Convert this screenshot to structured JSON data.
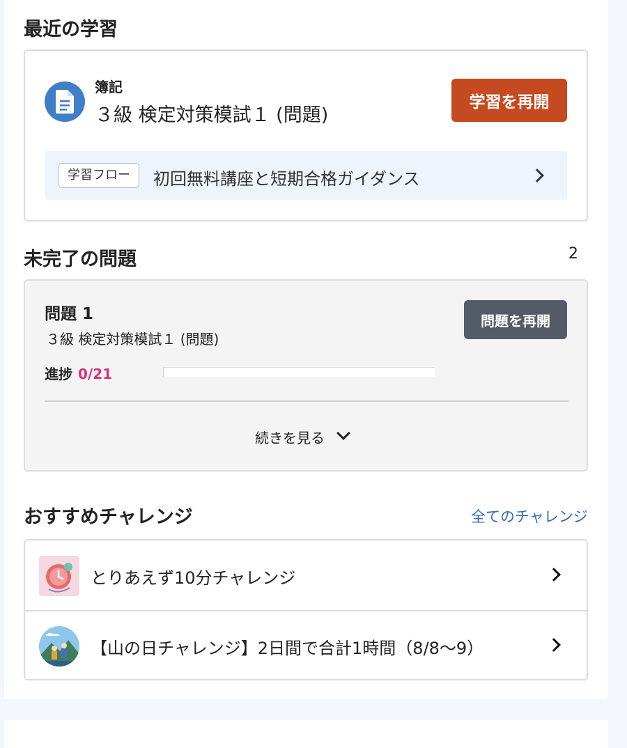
{
  "recent": {
    "title": "最近の学習",
    "subject": "簿記",
    "course": "３級 検定対策模試１ (問題)",
    "resume_label": "学習を再開",
    "flow_tag": "学習フロー",
    "flow_text": "初回無料講座と短期合格ガイダンス",
    "icon": "document-icon"
  },
  "incomplete": {
    "title": "未完了の問題",
    "count": "2",
    "item": {
      "title": "問題 1",
      "course": "３級 検定対策模試１ (問題)",
      "resume_label": "問題を再開",
      "progress_label": "進捗",
      "progress_value": "0/21",
      "progress_fraction": 0
    },
    "more_label": "続きを見る"
  },
  "challenges": {
    "title": "おすすめチャレンジ",
    "all_link": "全てのチャレンジ",
    "items": [
      {
        "label": "とりあえず10分チャレンジ",
        "icon": "clock-icon"
      },
      {
        "label": "【山の日チャレンジ】2日間で合計1時間（8/8〜9）",
        "icon": "mountain-hikers-icon"
      }
    ]
  },
  "colors": {
    "resume_button": "#c64a1f",
    "question_button": "#535c66",
    "progress_accent": "#d6337a",
    "link": "#2f6db5",
    "recent_icon_bg": "#3f7fc8"
  }
}
